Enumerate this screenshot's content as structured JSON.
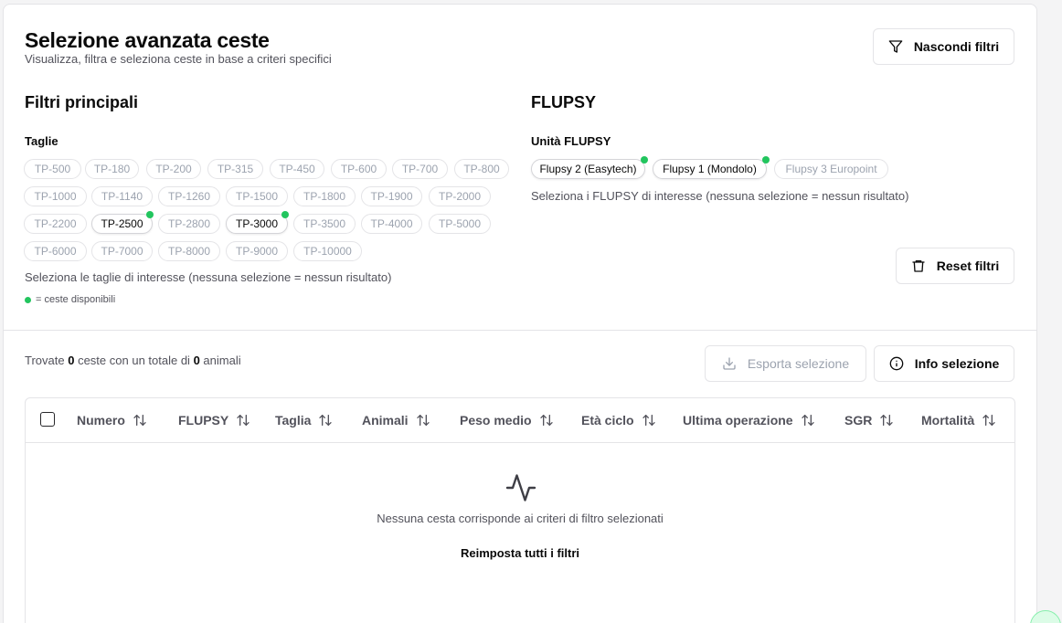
{
  "header": {
    "title": "Selezione avanzata ceste",
    "subtitle": "Visualizza, filtra e seleziona ceste in base a criteri specifici",
    "toggle_filters_label": "Nascondi filtri"
  },
  "filters": {
    "title": "Filtri principali",
    "sizes_label": "Taglie",
    "sizes": [
      "TP-500",
      "TP-180",
      "TP-200",
      "TP-315",
      "TP-450",
      "TP-600",
      "TP-700",
      "TP-800",
      "TP-1000",
      "TP-1140",
      "TP-1260",
      "TP-1500",
      "TP-1800",
      "TP-1900",
      "TP-2000",
      "TP-2200",
      "TP-2500",
      "TP-2800",
      "TP-3000",
      "TP-3500",
      "TP-4000",
      "TP-5000",
      "TP-6000",
      "TP-7000",
      "TP-8000",
      "TP-9000",
      "TP-10000"
    ],
    "sizes_available": [
      "TP-2500",
      "TP-3000"
    ],
    "sizes_help": "Seleziona le taglie di interesse (nessuna selezione = nessun risultato)",
    "legend": "= ceste disponibili"
  },
  "flupsy": {
    "title": "FLUPSY",
    "units_label": "Unità FLUPSY",
    "units": [
      "Flupsy 2 (Easytech)",
      "Flupsy 1 (Mondolo)",
      "Flupsy 3 Europoint"
    ],
    "units_available": [
      "Flupsy 2 (Easytech)",
      "Flupsy 1 (Mondolo)"
    ],
    "help": "Seleziona i FLUPSY di interesse (nessuna selezione = nessun risultato)",
    "reset_label": "Reset filtri"
  },
  "results": {
    "prefix": "Trovate",
    "basket_count": "0",
    "middle": "ceste con un totale di",
    "animal_count": "0",
    "suffix": "animali",
    "export_label": "Esporta selezione",
    "info_label": "Info selezione"
  },
  "table": {
    "columns": [
      "Numero",
      "FLUPSY",
      "Taglia",
      "Animali",
      "Peso medio",
      "Età ciclo",
      "Ultima operazione",
      "SGR",
      "Mortalità"
    ],
    "empty_message": "Nessuna cesta corrisponde ai criteri di filtro selezionati",
    "reset_all_label": "Reimposta tutti i filtri"
  },
  "colors": {
    "available_dot": "#22c55e",
    "border": "#e4e4e7",
    "muted_text": "#52525b",
    "inactive_chip_text": "#9ca3af"
  }
}
